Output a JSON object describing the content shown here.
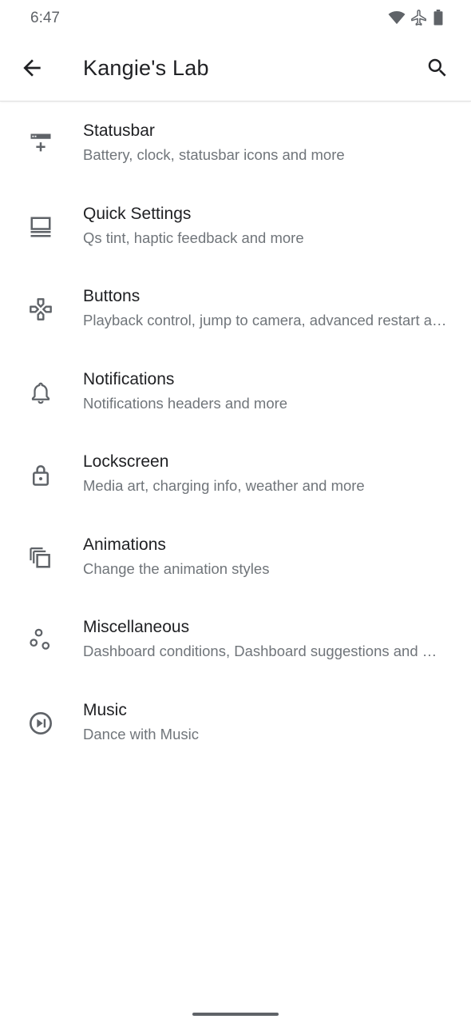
{
  "status_bar": {
    "time": "6:47",
    "icons": [
      "wifi-icon",
      "airplane-icon",
      "battery-icon"
    ]
  },
  "toolbar": {
    "back_icon": "arrow-back-icon",
    "title": "Kangie's Lab",
    "search_icon": "search-icon"
  },
  "items": [
    {
      "icon": "statusbar-icon",
      "title": "Statusbar",
      "summary": "Battery, clock, statusbar icons and more"
    },
    {
      "icon": "quick-settings-icon",
      "title": "Quick Settings",
      "summary": "Qs tint, haptic feedback and more"
    },
    {
      "icon": "gamepad-icon",
      "title": "Buttons",
      "summary": "Playback control, jump to camera, advanced restart and more"
    },
    {
      "icon": "bell-icon",
      "title": "Notifications",
      "summary": "Notifications headers and more"
    },
    {
      "icon": "lock-icon",
      "title": "Lockscreen",
      "summary": "Media art, charging info, weather and more"
    },
    {
      "icon": "layers-icon",
      "title": "Animations",
      "summary": "Change the animation styles"
    },
    {
      "icon": "bubbles-icon",
      "title": "Miscellaneous",
      "summary": "Dashboard conditions, Dashboard suggestions and more"
    },
    {
      "icon": "play-pause-icon",
      "title": "Music",
      "summary": "Dance with Music"
    }
  ],
  "colors": {
    "icon": "#5f6368",
    "title": "#202124",
    "summary": "#70757a"
  }
}
